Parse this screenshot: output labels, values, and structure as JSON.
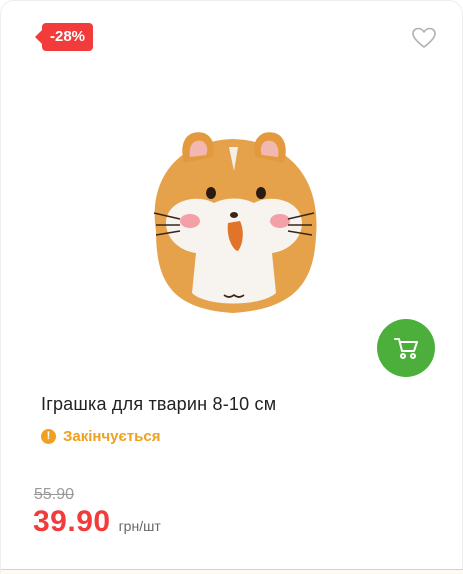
{
  "product": {
    "discount": "-28%",
    "name": "Іграшка для тварин 8-10 см",
    "stock_status": "Закінчується",
    "old_price": "55.90",
    "price": "39.90",
    "unit": "грн/шт"
  },
  "icons": {
    "favorite": "heart-outline-icon",
    "cart": "cart-icon",
    "warning": "exclamation-circle-icon"
  },
  "colors": {
    "discount_badge": "#f23b3b",
    "cart_button": "#4caf3c",
    "stock_warning": "#f0a020",
    "price": "#f23b3b"
  }
}
